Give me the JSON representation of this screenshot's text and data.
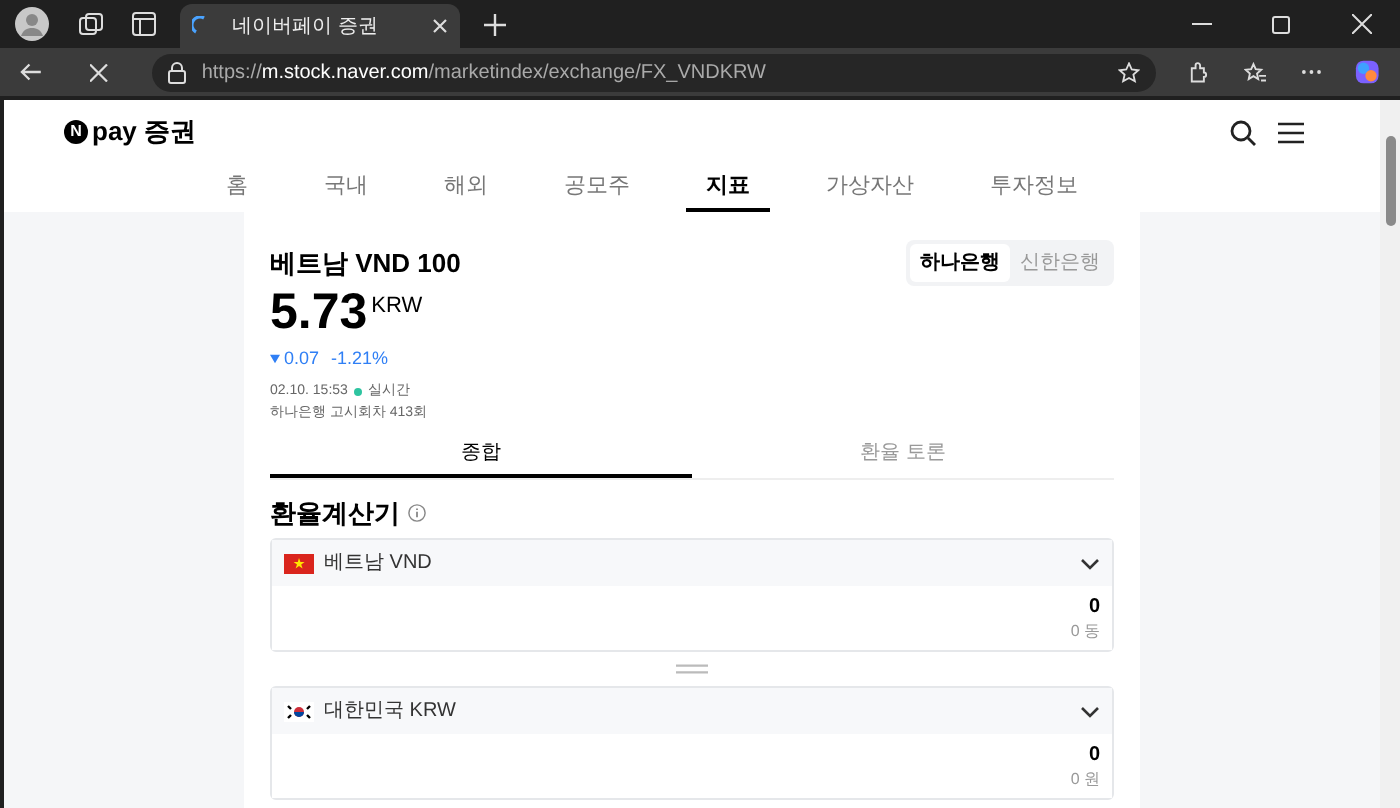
{
  "browser": {
    "tabs": [
      {
        "title": "네이버페이 증권",
        "selected": true,
        "loading": true
      }
    ],
    "url": {
      "scheme": "https://",
      "host": "m.stock.naver.com",
      "path": "/marketindex/exchange/FX_VNDKRW"
    }
  },
  "header": {
    "logo_mark": "N",
    "logo_text": "pay 증권"
  },
  "nav": [
    {
      "label": "홈",
      "selected": false
    },
    {
      "label": "국내",
      "selected": false
    },
    {
      "label": "해외",
      "selected": false
    },
    {
      "label": "공모주",
      "selected": false
    },
    {
      "label": "지표",
      "selected": true
    },
    {
      "label": "가상자산",
      "selected": false
    },
    {
      "label": "투자정보",
      "selected": false
    }
  ],
  "quote": {
    "title": "베트남 VND 100",
    "banks": [
      {
        "label": "하나은행",
        "selected": true
      },
      {
        "label": "신한은행",
        "selected": false
      }
    ],
    "price": "5.73",
    "unit": "KRW",
    "falling": true,
    "change": "0.07",
    "percent": "-1.21%",
    "time": "02.10. 15:53",
    "live": "실시간",
    "notice": "하나은행 고시회차 413회"
  },
  "tabs": [
    {
      "label": "종합",
      "selected": true
    },
    {
      "label": "환율 토론",
      "selected": false
    }
  ],
  "calculator": {
    "title": "환율계산기",
    "rows": [
      {
        "kind": "vietnam",
        "currency": "베트남 VND",
        "value": "0",
        "sub": "0 동"
      },
      {
        "kind": "korea",
        "currency": "대한민국 KRW",
        "value": "0",
        "sub": "0 원"
      }
    ]
  }
}
